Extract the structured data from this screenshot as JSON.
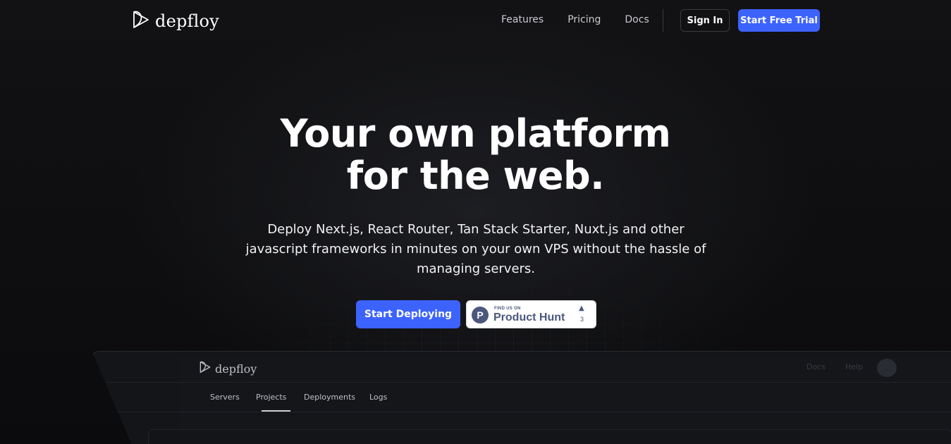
{
  "nav": {
    "logo_text": "depfloy",
    "links": [
      "Features",
      "Pricing",
      "Docs"
    ],
    "sign_in": "Sign In",
    "trial": "Start Free Trial"
  },
  "hero": {
    "title_line1": "Your own platform",
    "title_line2": "for the web.",
    "subtitle": "Deploy Next.js, React Router, Tan Stack Starter, Nuxt.js and other javascript frameworks in minutes on your own VPS without the hassle of managing servers.",
    "cta": "Start Deploying",
    "product_hunt": {
      "small": "FIND US ON",
      "name": "Product Hunt",
      "letter": "P",
      "count": "3"
    }
  },
  "preview": {
    "logo_text": "depfloy",
    "right_links": [
      "Docs",
      "Help"
    ],
    "tabs": [
      "Servers",
      "Projects",
      "Deployments",
      "Logs"
    ]
  },
  "colors": {
    "accent": "#3d63ff",
    "background": "#0d0d0f",
    "product_hunt": "#4b587c"
  }
}
